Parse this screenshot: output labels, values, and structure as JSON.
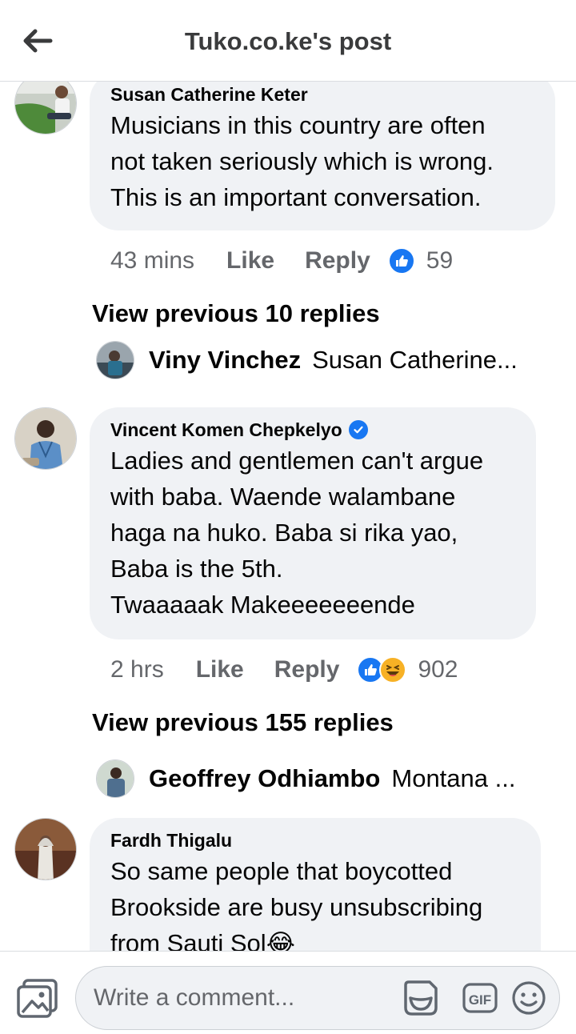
{
  "header": {
    "title": "Tuko.co.ke's post",
    "back_icon": "arrow-left-icon"
  },
  "comments": [
    {
      "author": "Susan Catherine Keter",
      "verified": false,
      "text": "Musicians in this country are often\nnot taken seriously which is wrong.\nThis is an important conversation.",
      "time": "43 mins",
      "like_label": "Like",
      "reply_label": "Reply",
      "reactions": [
        "like"
      ],
      "reaction_count": "59",
      "view_previous": "View previous 10 replies",
      "reply_preview": {
        "name": "Viny Vinchez",
        "snippet": "Susan Catherine..."
      }
    },
    {
      "author": "Vincent Komen Chepkelyo",
      "verified": true,
      "text": "Ladies and gentlemen can't argue\nwith baba. Waende walambane\nhaga na huko. Baba si rika yao,\nBaba is the 5th.\nTwaaaaak Makeeeeeeende",
      "time": "2 hrs",
      "like_label": "Like",
      "reply_label": "Reply",
      "reactions": [
        "like",
        "haha"
      ],
      "reaction_count": "902",
      "view_previous": "View previous 155 replies",
      "reply_preview": {
        "name": "Geoffrey Odhiambo",
        "snippet": "Montana ..."
      }
    },
    {
      "author": "Fardh Thigalu",
      "verified": false,
      "text": "So same people that boycotted\nBrookside are busy unsubscribing\nfrom Sauti Sol😂"
    }
  ],
  "composer": {
    "placeholder": "Write a comment...",
    "photo_icon": "photo-icon",
    "sticker_icon": "sticker-icon",
    "gif_label": "GIF",
    "emoji_icon": "emoji-icon"
  },
  "colors": {
    "accent": "#1877f2",
    "bubble": "#f0f2f5",
    "meta": "#65676b",
    "haha": "#f7b125"
  }
}
